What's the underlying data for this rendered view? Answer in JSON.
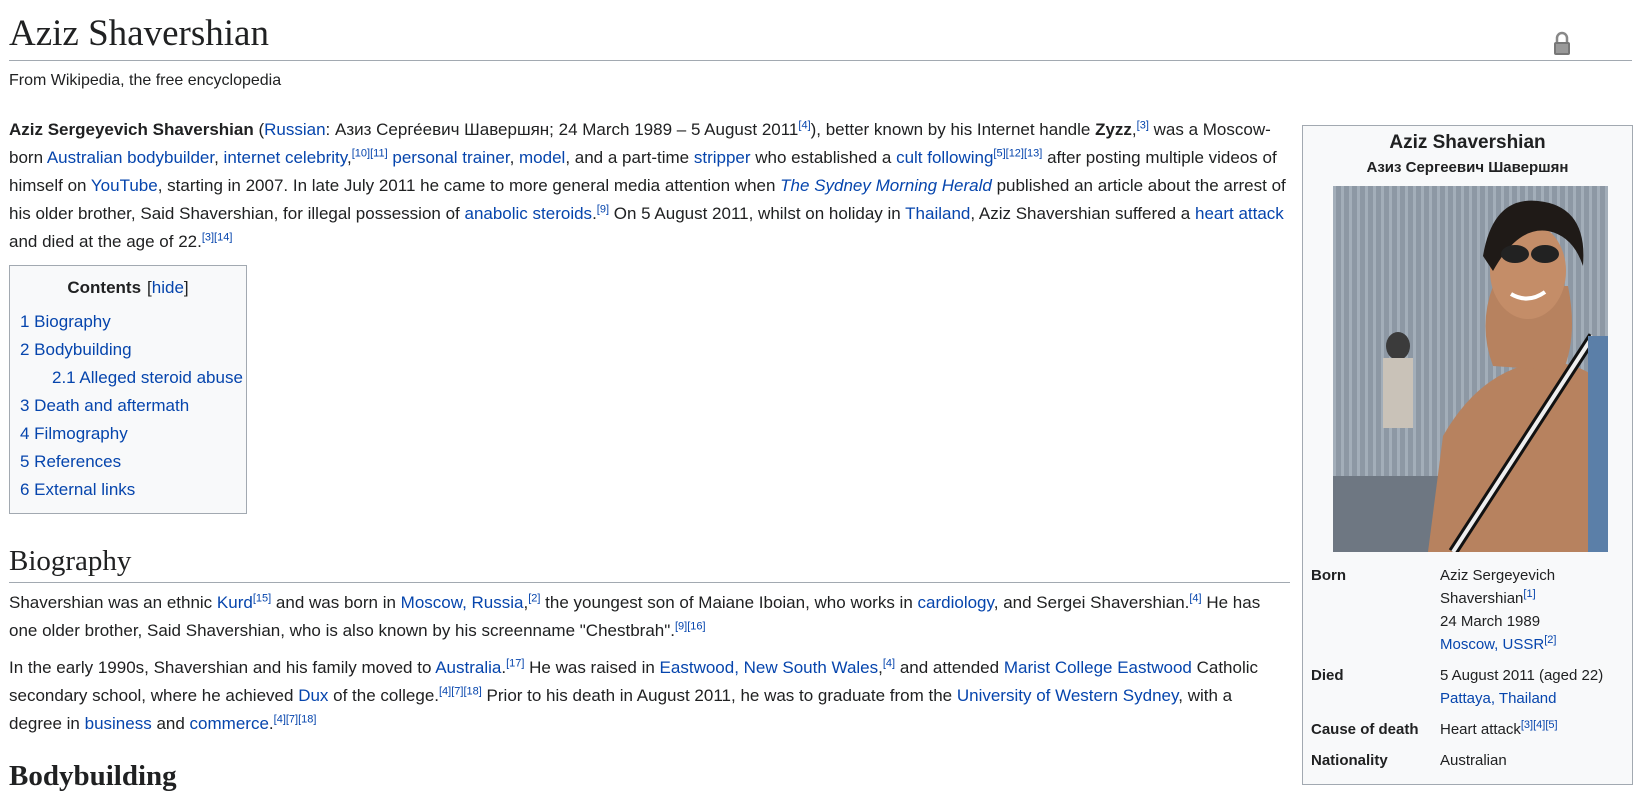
{
  "page": {
    "title": "Aziz Shavershian",
    "tagline": "From Wikipedia, the free encyclopedia"
  },
  "lead": {
    "name_bold": "Aziz Sergeyevich Shavershian",
    "t1": " (",
    "russian": "Russian",
    "t2": ": Азиз Серге́евич Шавершян; 24 March 1989 – 5 August 2011",
    "ref4": "[4]",
    "t3": "), better known by his Internet handle ",
    "handle": "Zyzz",
    "t4": ",",
    "ref3": "[3]",
    "t5": " was a Moscow-born ",
    "aus_bb": "Australian bodybuilder",
    "t6": ", ",
    "celeb": "internet celebrity",
    "t7": ",",
    "ref10_11": "[10][11]",
    "t8": " ",
    "trainer": "personal trainer",
    "t9": ", ",
    "model": "model",
    "t10": ", and a part-time ",
    "stripper": "stripper",
    "t11": " who established a ",
    "cult": "cult following",
    "ref5_12_13": "[5][12][13]",
    "t12": " after posting multiple videos of himself on ",
    "youtube": "YouTube",
    "t13": ", starting in 2007. In late July 2011 he came to more general media attention when ",
    "smh": "The Sydney Morning Herald",
    "t14": " published an article about the arrest of his older brother, Said Shavershian, for illegal possession of ",
    "steroids": "anabolic steroids",
    "t15": ".",
    "ref9": "[9]",
    "t16": " On 5 August 2011, whilst on holiday in ",
    "thailand": "Thailand",
    "t17": ", Aziz Shavershian suffered a ",
    "heart": "heart attack",
    "t18": " and died at the age of 22.",
    "ref3_14": "[3][14]"
  },
  "toc": {
    "title": "Contents",
    "hide_open": "[",
    "hide": "hide",
    "hide_close": "]",
    "items": [
      "1 Biography",
      "2 Bodybuilding",
      "2.1 Alleged steroid abuse",
      "3 Death and aftermath",
      "4 Filmography",
      "5 References",
      "6 External links"
    ]
  },
  "biography": {
    "heading": "Biography",
    "p1": {
      "t1": "Shavershian was an ethnic ",
      "kurd": "Kurd",
      "ref15": "[15]",
      "t2": " and was born in ",
      "moscow": "Moscow, Russia",
      "t3": ",",
      "ref2": "[2]",
      "t4": " the youngest son of Maiane Iboian, who works in ",
      "cardiology": "cardiology",
      "t5": ", and Sergei Shavershian.",
      "ref4": "[4]",
      "t6": " He has one older brother, Said Shavershian, who is also known by his screenname \"Chestbrah\".",
      "ref9_16": "[9][16]"
    },
    "p2": {
      "t1": "In the early 1990s, Shavershian and his family moved to ",
      "australia": "Australia",
      "t2": ".",
      "ref17": "[17]",
      "t3": " He was raised in ",
      "eastwood": "Eastwood, New South Wales",
      "t4": ",",
      "ref4": "[4]",
      "t5": " and attended ",
      "marist": "Marist College Eastwood",
      "t6": " Catholic secondary school, where he achieved ",
      "dux": "Dux",
      "t7": " of the college.",
      "ref4_7_18": "[4][7][18]",
      "t8": " Prior to his death in August 2011, he was to graduate from the ",
      "uws": "University of Western Sydney",
      "t9": ", with a degree in ",
      "business": "business",
      "t10": " and ",
      "commerce": "commerce",
      "t11": ".",
      "ref4_7_18b": "[4][7][18]"
    }
  },
  "next_heading": "Bodybuilding",
  "infobox": {
    "title": "Aziz Shavershian",
    "subtitle": "Азиз Сергеевич Шавершян",
    "born_label": "Born",
    "born_name": "Aziz Sergeyevich Shavershian",
    "born_ref": "[1]",
    "born_date": "24 March 1989",
    "born_place": "Moscow, USSR",
    "born_place_ref": "[2]",
    "died_label": "Died",
    "died_date": "5 August 2011 (aged 22)",
    "died_place": "Pattaya, Thailand",
    "cause_label": "Cause of death",
    "cause": "Heart attack",
    "cause_ref": "[3][4][5]",
    "nationality_label": "Nationality",
    "nationality": "Australian"
  },
  "colors": {
    "link": "#0645ad",
    "text": "#202122",
    "border": "#a2a9b1",
    "box_bg": "#f8f9fa"
  },
  "icons": {
    "lock": "lock-icon"
  }
}
